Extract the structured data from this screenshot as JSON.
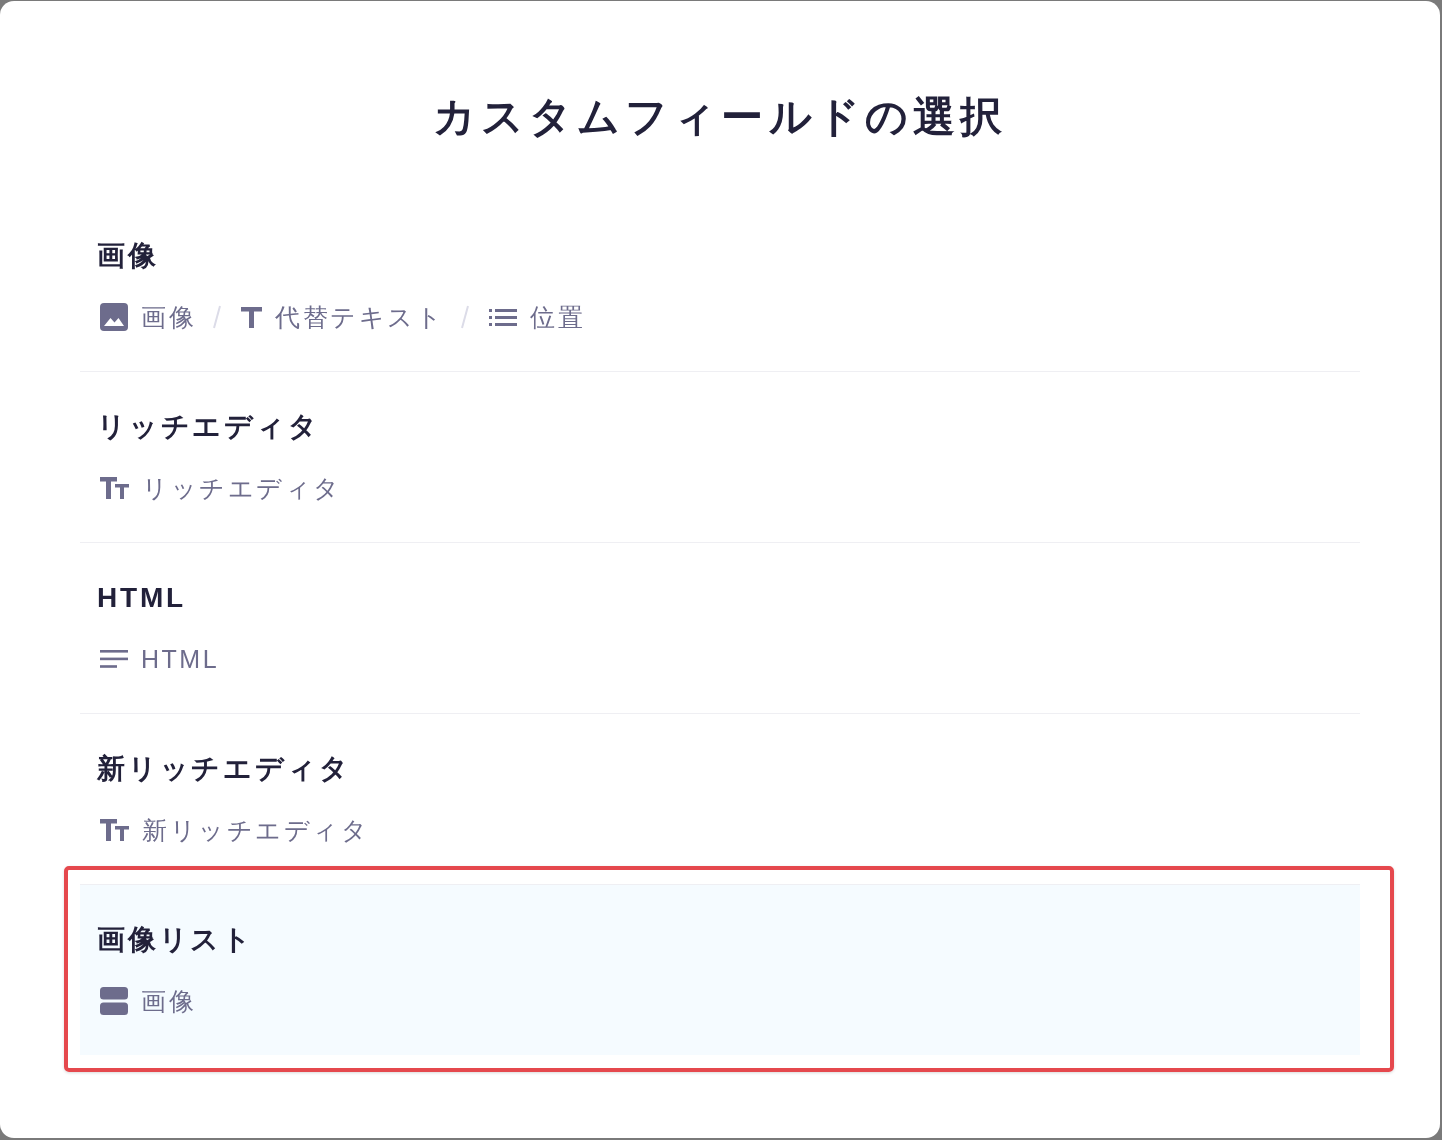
{
  "dialog": {
    "title": "カスタムフィールドの選択"
  },
  "options": [
    {
      "title": "画像",
      "selected": false,
      "outlined": false,
      "fields": [
        {
          "kind": "image",
          "label": "画像"
        },
        {
          "kind": "text",
          "label": "代替テキスト"
        },
        {
          "kind": "list",
          "label": "位置"
        }
      ]
    },
    {
      "title": "リッチエディタ",
      "selected": false,
      "outlined": false,
      "fields": [
        {
          "kind": "richtext",
          "label": "リッチエディタ"
        }
      ]
    },
    {
      "title": "HTML",
      "selected": false,
      "outlined": false,
      "fields": [
        {
          "kind": "html",
          "label": "HTML"
        }
      ]
    },
    {
      "title": "新リッチエディタ",
      "selected": false,
      "outlined": false,
      "fields": [
        {
          "kind": "richtext",
          "label": "新リッチエディタ"
        }
      ]
    },
    {
      "title": "画像リスト",
      "selected": true,
      "outlined": true,
      "fields": [
        {
          "kind": "repeater",
          "label": "画像"
        }
      ]
    }
  ]
}
